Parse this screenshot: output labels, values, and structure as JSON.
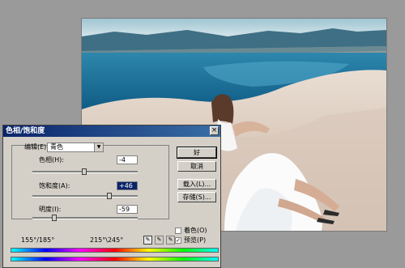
{
  "dialog": {
    "title": "色相/饱和度",
    "close_glyph": "×",
    "edit_label": "编辑(E):",
    "edit_value": "青色",
    "hue": {
      "label": "色相(H):",
      "value": "-4",
      "level": 0.49
    },
    "saturation": {
      "label": "饱和度(A):",
      "value": "+46",
      "level": 0.73
    },
    "lightness": {
      "label": "明度(I):",
      "value": "-59",
      "level": 0.21
    },
    "buttons": {
      "ok": "好",
      "cancel": "取消",
      "load": "载入(L)...",
      "save": "存储(S)..."
    },
    "colorize_label": "着色(O)",
    "preview_label": "预览(P)",
    "preview_checked": "✓",
    "range_left": "155°/185°",
    "range_right": "215°\\245°"
  },
  "icons": {
    "eyedropper": "eyedropper-icon",
    "eyedropper_add": "eyedropper-plus-icon",
    "eyedropper_subtract": "eyedropper-minus-icon"
  },
  "colors": {
    "titlebar": "#0a246a",
    "dialog_bg": "#d4d0c8",
    "sky": "#dbe9ee",
    "water": "#2a8fb6"
  }
}
